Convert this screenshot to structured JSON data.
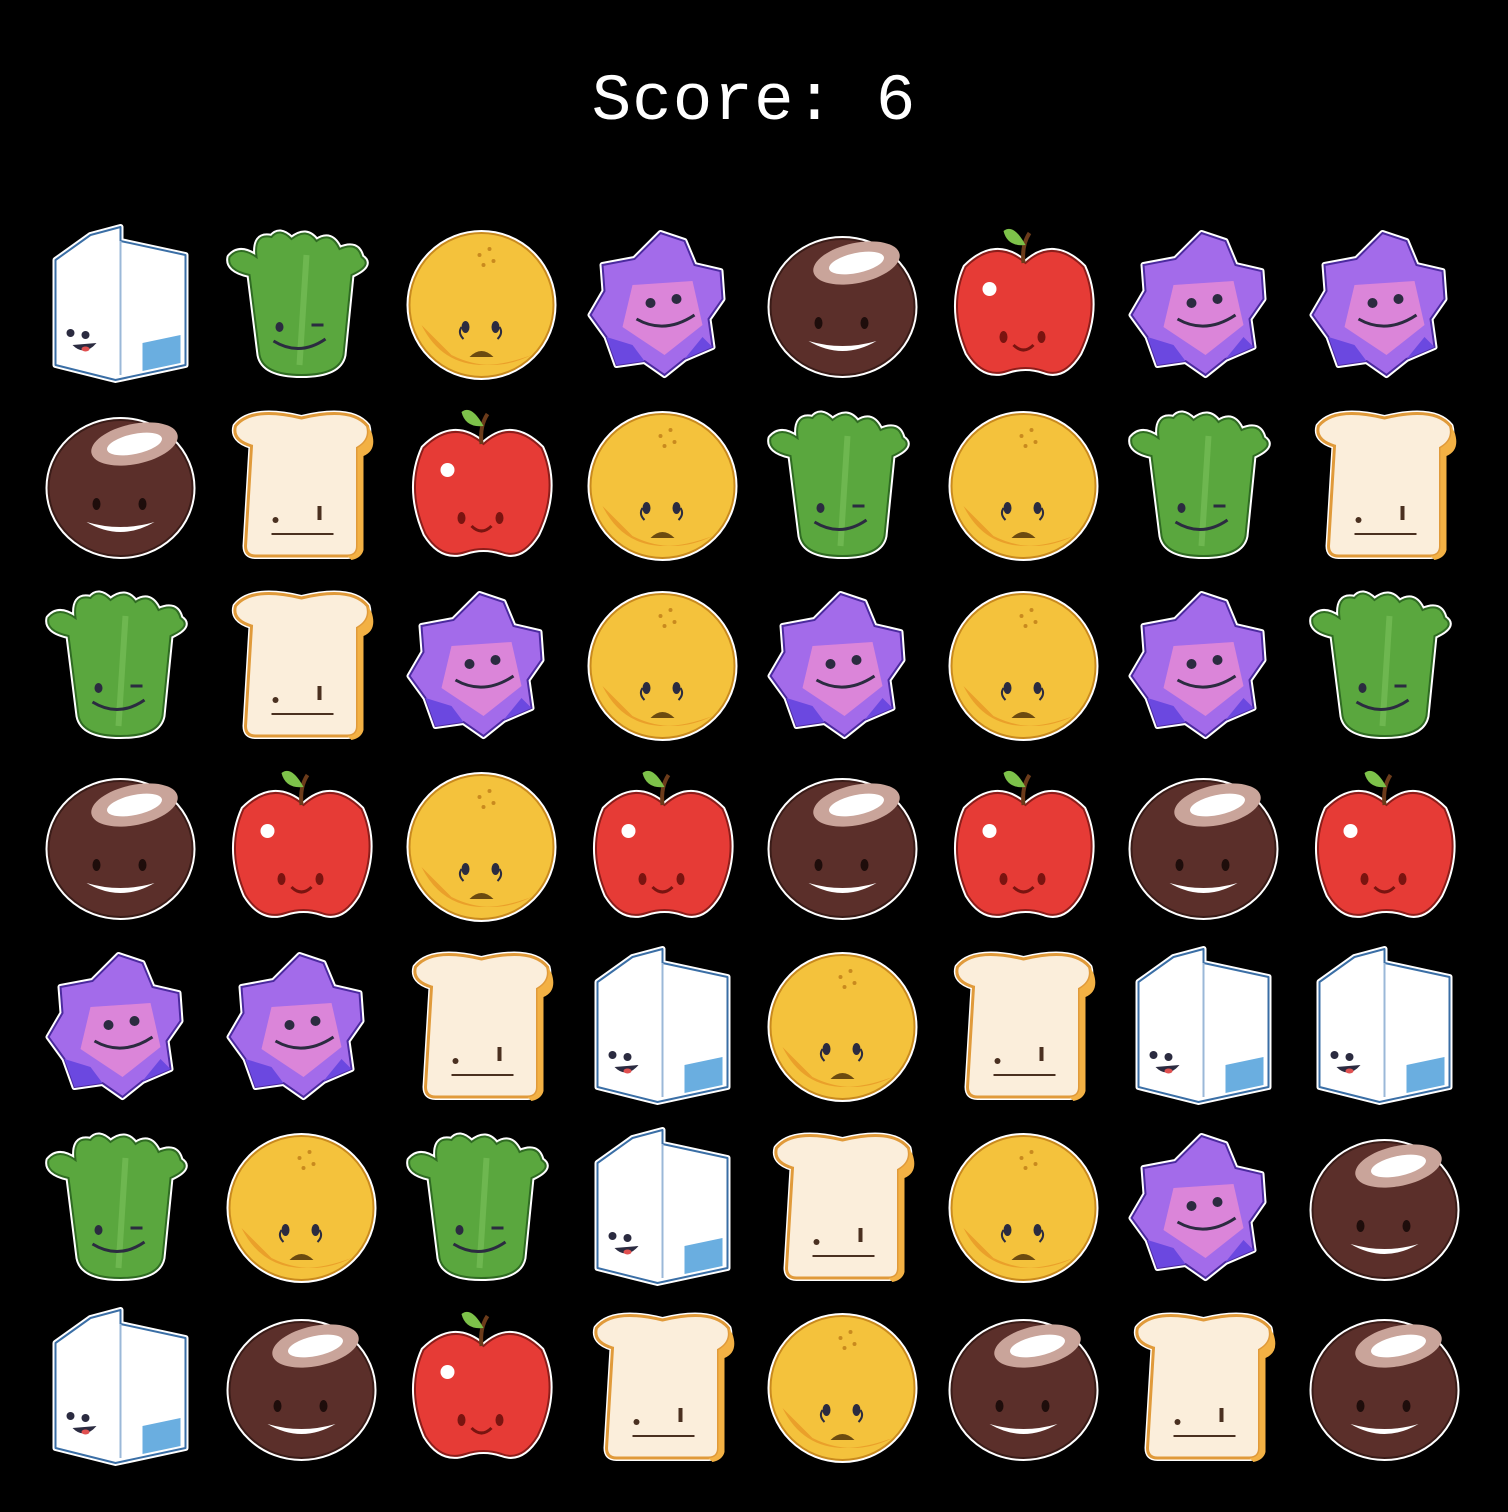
{
  "score": {
    "text": "Score: 6"
  },
  "piece_types": {
    "milk": {
      "icon": "milk-carton-icon",
      "color": "#ffffff"
    },
    "broccoli": {
      "icon": "broccoli-icon",
      "color": "#5aa73e"
    },
    "orange": {
      "icon": "orange-icon",
      "color": "#f4c23c"
    },
    "gem": {
      "icon": "purple-gem-icon",
      "color": "#a36bea"
    },
    "coconut": {
      "icon": "coconut-icon",
      "color": "#5b2f2a"
    },
    "apple": {
      "icon": "apple-icon",
      "color": "#e63b36"
    },
    "bread": {
      "icon": "bread-icon",
      "color": "#fbeedb"
    }
  },
  "board": {
    "rows": 7,
    "cols": 8,
    "grid": [
      [
        "milk",
        "broccoli",
        "orange",
        "gem",
        "coconut",
        "apple",
        "gem",
        "gem"
      ],
      [
        "coconut",
        "bread",
        "apple",
        "orange",
        "broccoli",
        "orange",
        "broccoli",
        "bread"
      ],
      [
        "broccoli",
        "bread",
        "gem",
        "orange",
        "gem",
        "orange",
        "gem",
        "broccoli"
      ],
      [
        "coconut",
        "apple",
        "orange",
        "apple",
        "coconut",
        "apple",
        "coconut",
        "apple"
      ],
      [
        "gem",
        "gem",
        "bread",
        "milk",
        "orange",
        "bread",
        "milk",
        "milk"
      ],
      [
        "broccoli",
        "orange",
        "broccoli",
        "milk",
        "bread",
        "orange",
        "gem",
        "coconut"
      ],
      [
        "milk",
        "coconut",
        "apple",
        "bread",
        "orange",
        "coconut",
        "bread",
        "coconut"
      ]
    ]
  }
}
